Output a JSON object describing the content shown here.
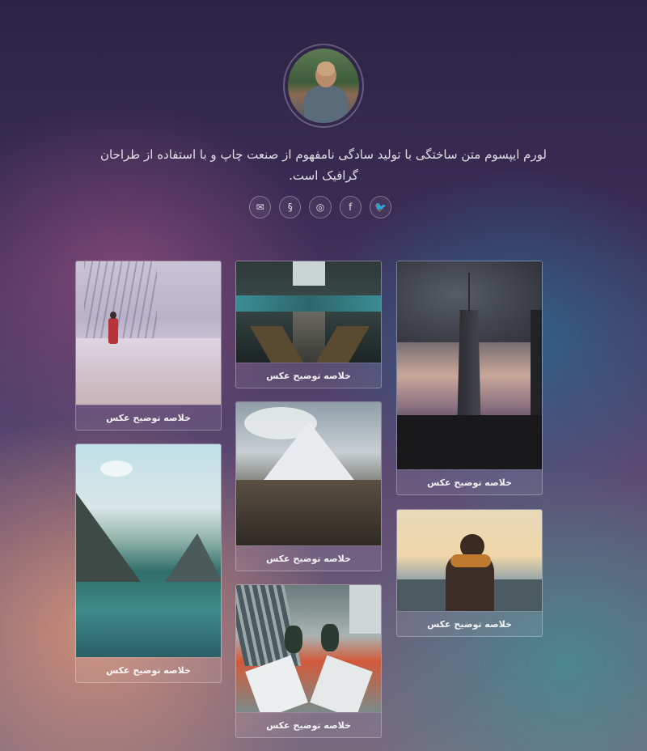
{
  "profile": {
    "bio": "لورم ایپسوم متن ساختگی با تولید سادگی نامفهوم از صنعت چاپ و با استفاده از طراحان گرافیک است."
  },
  "socials": [
    {
      "name": "email-icon",
      "glyph": "✉"
    },
    {
      "name": "skype-icon",
      "glyph": "§"
    },
    {
      "name": "instagram-icon",
      "glyph": "◎"
    },
    {
      "name": "facebook-icon",
      "glyph": "f"
    },
    {
      "name": "twitter-icon",
      "glyph": "🐦"
    }
  ],
  "gallery": {
    "caption_text": "خلاصه توضیح عکس",
    "cards": [
      {
        "id": "snow-forest",
        "caption": "خلاصه توضیح عکس"
      },
      {
        "id": "subway-escalator",
        "caption": "خلاصه توضیح عکس"
      },
      {
        "id": "city-tower",
        "caption": "خلاصه توضیح عکس"
      },
      {
        "id": "mountain-peak",
        "caption": "خلاصه توضیح عکس"
      },
      {
        "id": "lake-valley",
        "caption": "خلاصه توضیح عکس"
      },
      {
        "id": "sea-sunset-person",
        "caption": "خلاصه توضیح عکس"
      },
      {
        "id": "feet-above-city",
        "caption": "خلاصه توضیح عکس"
      }
    ]
  }
}
